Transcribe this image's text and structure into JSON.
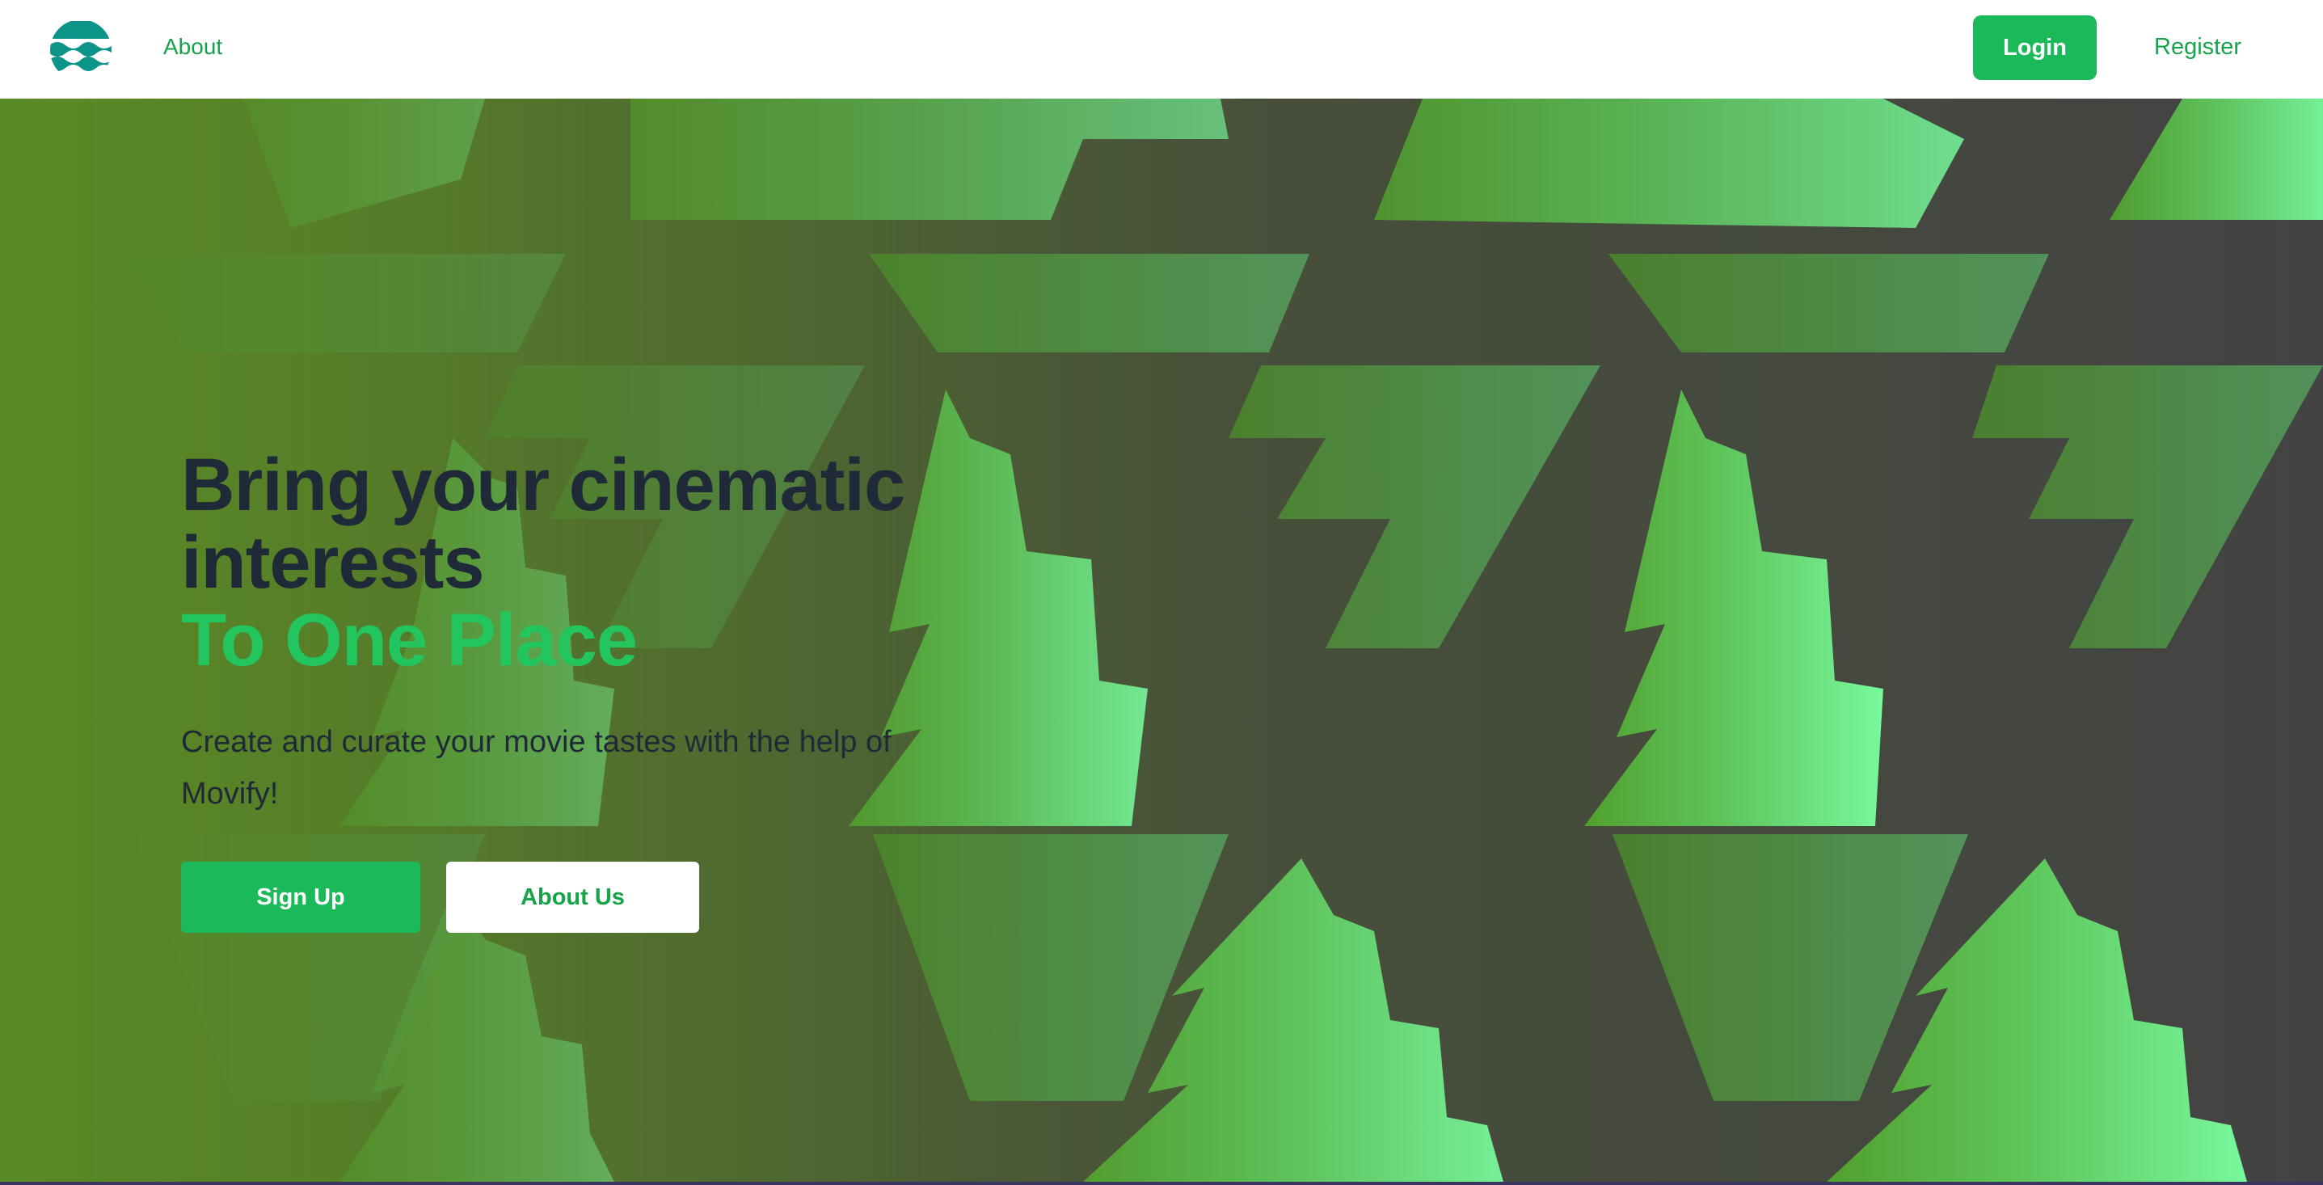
{
  "nav": {
    "logo_icon": "waves-logo-icon",
    "about_label": "About",
    "login_label": "Login",
    "register_label": "Register"
  },
  "hero": {
    "headline_line1": "Bring your cinematic",
    "headline_line2": "interests",
    "headline_accent": "To One Place",
    "subtitle": "Create and curate your movie tastes with the help of Movify!",
    "signup_label": "Sign Up",
    "aboutus_label": "About Us"
  },
  "colors": {
    "brand_green": "#1cb95a",
    "accent_text": "#22c55e",
    "link_green": "#16a34a",
    "heading_dark": "#1f2937",
    "logo_teal": "#0d9488"
  }
}
